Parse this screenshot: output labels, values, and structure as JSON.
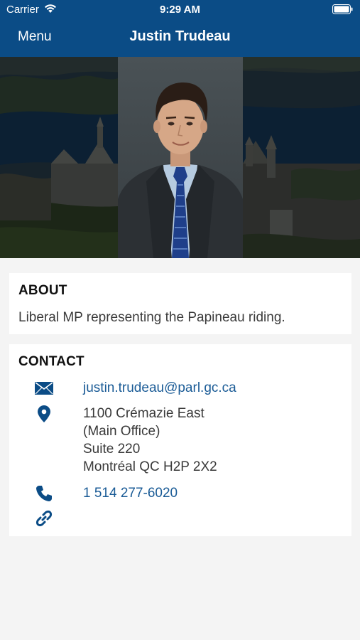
{
  "status_bar": {
    "carrier": "Carrier",
    "time": "9:29 AM"
  },
  "nav": {
    "menu_label": "Menu",
    "title": "Justin Trudeau"
  },
  "about": {
    "heading": "ABOUT",
    "text": "Liberal MP representing the Papineau riding."
  },
  "contact": {
    "heading": "CONTACT",
    "email": "justin.trudeau@parl.gc.ca",
    "address": {
      "line1": "1100 Crémazie East",
      "line2": "(Main Office)",
      "line3": "Suite 220",
      "line4": "Montréal QC  H2P 2X2"
    },
    "phone": "1 514 277-6020"
  },
  "colors": {
    "nav_bg": "#0b4c86",
    "link": "#1a5b96",
    "icon": "#0b4c86",
    "page_bg": "#f4f4f4"
  },
  "icons": {
    "email": "envelope-icon",
    "address": "map-pin-icon",
    "phone": "phone-icon",
    "website": "link-icon"
  }
}
